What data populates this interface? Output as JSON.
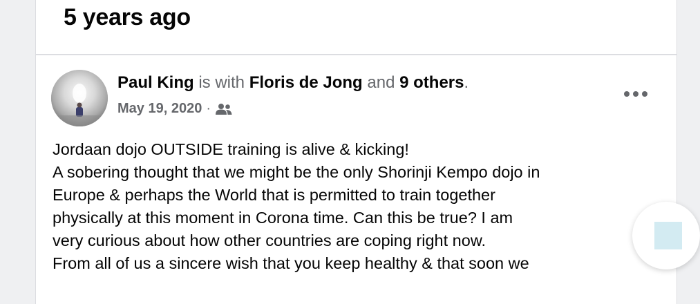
{
  "memory": {
    "title": "5 years ago"
  },
  "post": {
    "author": "Paul King",
    "with_text": "is with",
    "tagged_person": "Floris de Jong",
    "and_text": "and",
    "others": "9 others",
    "period": ".",
    "date": "May 19, 2020",
    "separator": "·",
    "audience_icon": "friends-icon",
    "more_icon": "more-options-icon",
    "lines": [
      "Jordaan dojo OUTSIDE training is alive & kicking!",
      "A sobering thought that we might be the only Shorinji Kempo dojo in",
      "Europe & perhaps the World that is permitted to train together",
      "physically at this moment in Corona time. Can this be true? I am",
      "very curious about how other countries are coping right now.",
      "From all of us a sincere wish that you keep healthy & that soon we"
    ]
  },
  "floating_action": {
    "icon": "square-icon",
    "color": "#d3ebf2"
  }
}
